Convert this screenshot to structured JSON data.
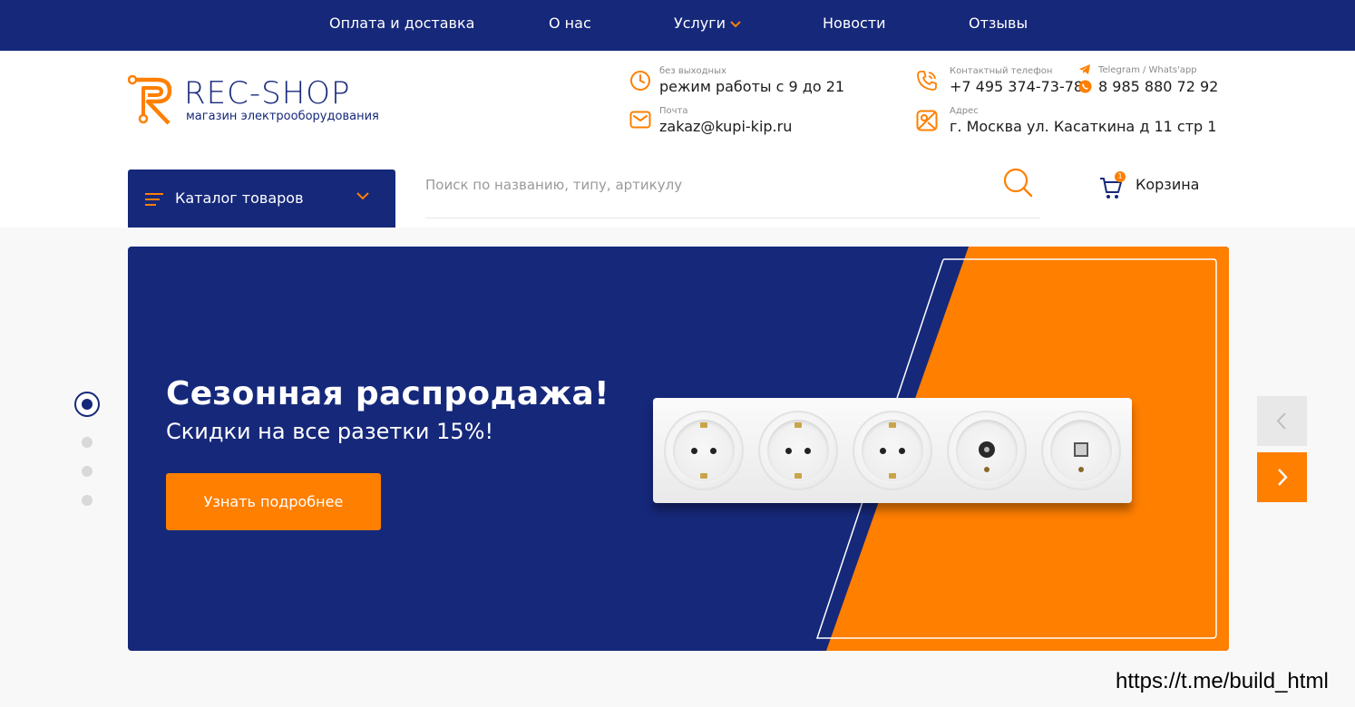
{
  "topnav": {
    "items": [
      {
        "label": "Оплата и доставка"
      },
      {
        "label": "О нас"
      },
      {
        "label": "Услуги"
      },
      {
        "label": "Новости"
      },
      {
        "label": "Отзывы"
      }
    ]
  },
  "header": {
    "logo_text": "REC-SHOP",
    "logo_subtitle": "магазин электрооборудования",
    "hours": {
      "small": "без выходных",
      "main": "режим работы с 9 до 21",
      "icon": "clock-icon"
    },
    "email": {
      "small": "Почта",
      "main": "zakaz@kupi-kip.ru",
      "icon": "mail-icon"
    },
    "phone": {
      "small": "Контактный телефон",
      "main": "+7 495 374-73-78",
      "icon": "phone-icon"
    },
    "messenger": {
      "small": "Telegram / Whats'app",
      "main": "8 985 880 72 92",
      "icon": "telegram-icon"
    },
    "address": {
      "small": "Адрес",
      "main": "г. Москва ул. Касаткина д 11 стр 1",
      "icon": "map-icon"
    }
  },
  "catalog": {
    "label": "Каталог товаров"
  },
  "search": {
    "placeholder": "Поиск по названию, типу, артикулу"
  },
  "cart": {
    "label": "Корзина",
    "count": "1"
  },
  "slider": {
    "title": "Сезонная распродажа!",
    "subtitle": "Скидки на все разетки 15%!",
    "button": "Узнать подробнее",
    "active_slide": 1,
    "total_slides": 4
  },
  "watermark": "https://t.me/build_html",
  "colors": {
    "navy": "#16287a",
    "orange": "#ff7f00"
  }
}
